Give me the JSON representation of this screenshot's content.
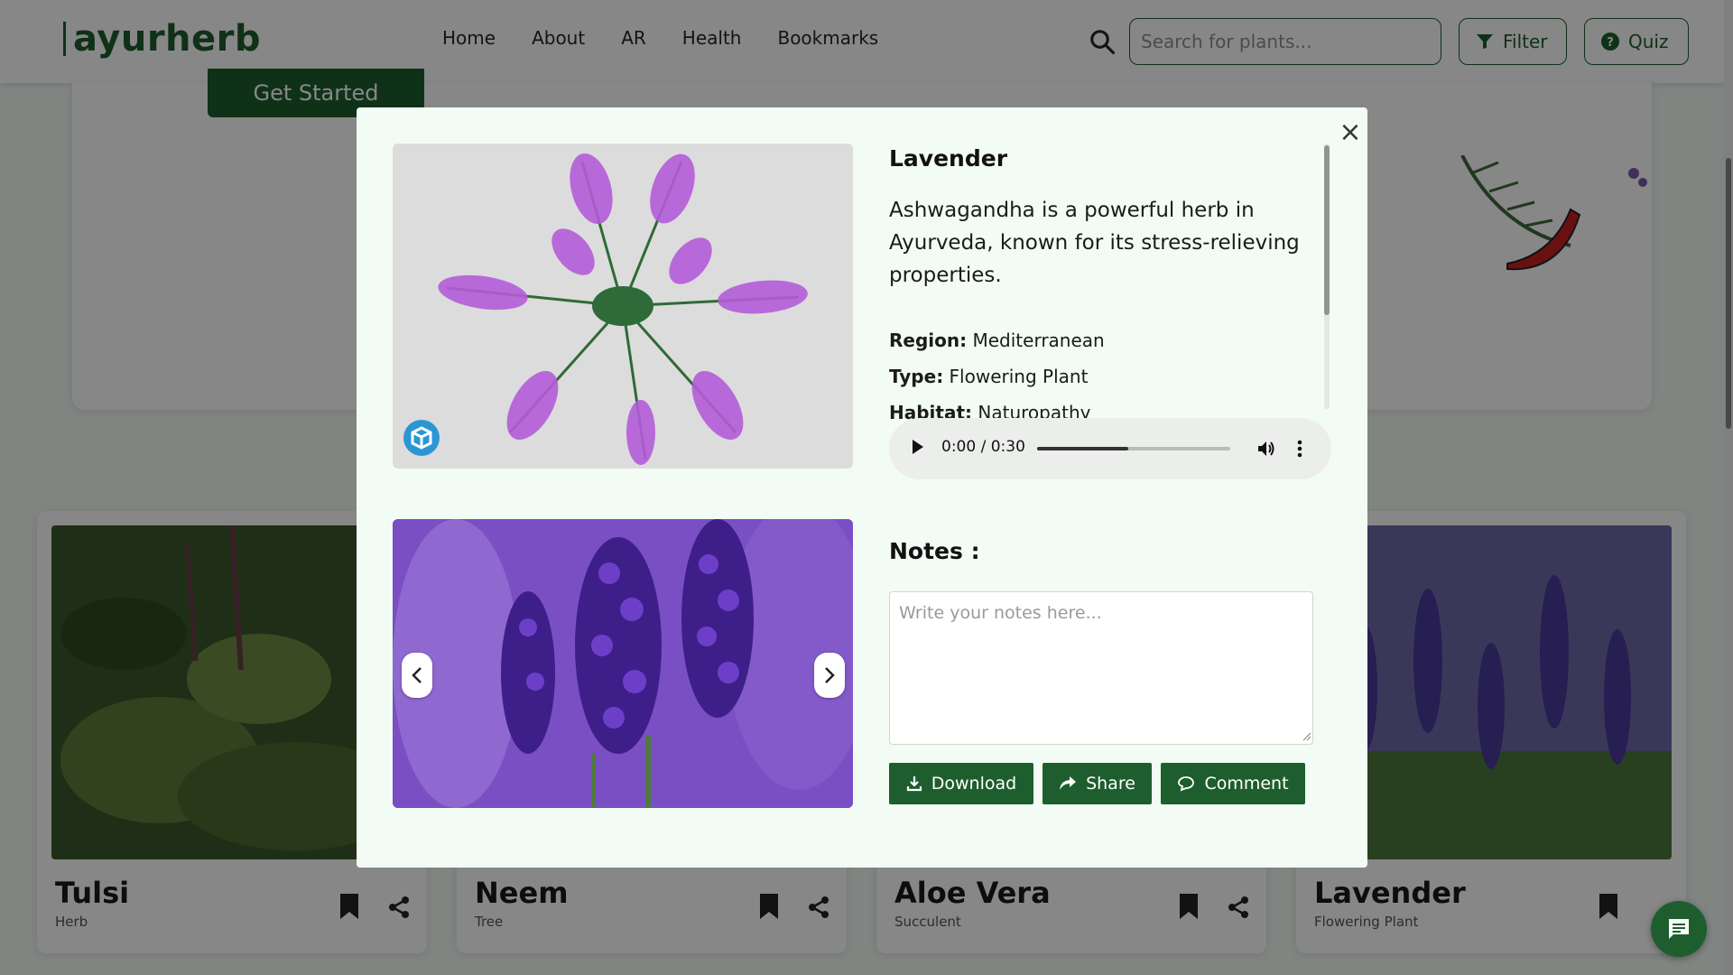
{
  "app": {
    "logo": "ayurherb"
  },
  "nav": {
    "links": [
      "Home",
      "About",
      "AR",
      "Health",
      "Bookmarks"
    ]
  },
  "search": {
    "placeholder": "Search for plants..."
  },
  "header_buttons": {
    "filter": "Filter",
    "quiz": "Quiz"
  },
  "hero": {
    "cta_label": "Get Started"
  },
  "plant_cards": [
    {
      "name": "Tulsi",
      "type": "Herb"
    },
    {
      "name": "Neem",
      "type": "Tree"
    },
    {
      "name": "Aloe Vera",
      "type": "Succulent"
    },
    {
      "name": "Lavender",
      "type": "Flowering Plant"
    }
  ],
  "modal": {
    "title": "Lavender",
    "description": "Ashwagandha is a powerful herb in Ayurveda, known for its stress-relieving properties.",
    "details": [
      {
        "label": "Region:",
        "value": "Mediterranean"
      },
      {
        "label": "Type:",
        "value": "Flowering Plant"
      },
      {
        "label": "Habitat:",
        "value": "Naturopathy"
      }
    ],
    "audio": {
      "time": "0:00 / 0:30",
      "progress_fraction": 0.47
    },
    "notes_title": "Notes :",
    "notes_placeholder": "Write your notes here...",
    "actions": {
      "download": "Download",
      "share": "Share",
      "comment": "Comment"
    }
  },
  "colors": {
    "brand": "#1e5e2e",
    "ar_badge": "#2a97d4",
    "modal_bg": "#f2fcf4",
    "lavender": "#9b4fd6"
  }
}
